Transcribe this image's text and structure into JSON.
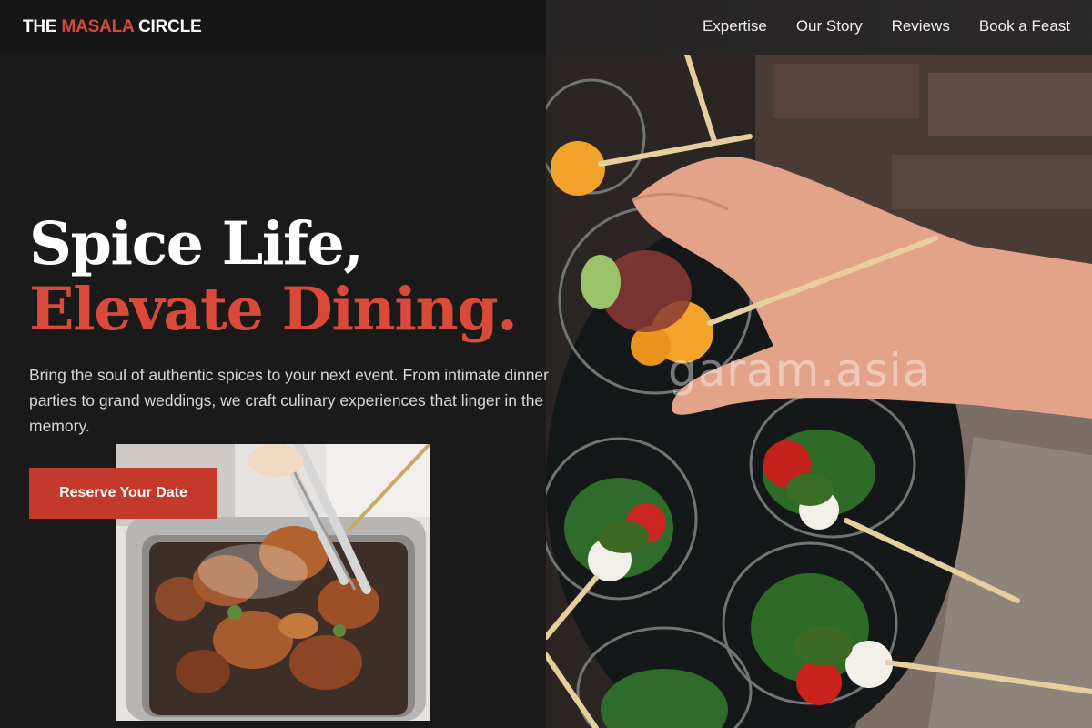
{
  "nav": {
    "logo_prefix": "THE ",
    "logo_accent": "MASALA",
    "logo_suffix": " CIRCLE",
    "links": [
      "Expertise",
      "Our Story",
      "Reviews",
      "Book a Feast"
    ]
  },
  "hero": {
    "headline_line1": "Spice Life,",
    "headline_line2": "Elevate Dining.",
    "intro": "Bring the soul of authentic spices to your next event. From intimate dinner parties to grand weddings, we craft culinary experiences that linger in the memory.",
    "cta_label": "Reserve Your Date",
    "image_watermark": "garam.asia"
  },
  "colors": {
    "background": "#1b1a1b",
    "accent": "#d94a3a",
    "button": "#c4392c",
    "text": "#ffffff",
    "muted_text": "#d9d6d3"
  }
}
